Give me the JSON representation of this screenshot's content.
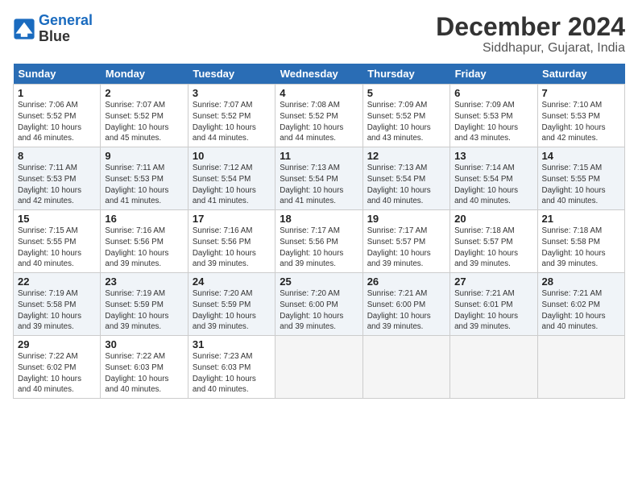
{
  "header": {
    "logo_line1": "General",
    "logo_line2": "Blue",
    "month": "December 2024",
    "location": "Siddhapur, Gujarat, India"
  },
  "weekdays": [
    "Sunday",
    "Monday",
    "Tuesday",
    "Wednesday",
    "Thursday",
    "Friday",
    "Saturday"
  ],
  "weeks": [
    [
      {
        "day": 1,
        "rise": "7:06 AM",
        "set": "5:52 PM",
        "daylight": "10 hours and 46 minutes."
      },
      {
        "day": 2,
        "rise": "7:07 AM",
        "set": "5:52 PM",
        "daylight": "10 hours and 45 minutes."
      },
      {
        "day": 3,
        "rise": "7:07 AM",
        "set": "5:52 PM",
        "daylight": "10 hours and 44 minutes."
      },
      {
        "day": 4,
        "rise": "7:08 AM",
        "set": "5:52 PM",
        "daylight": "10 hours and 44 minutes."
      },
      {
        "day": 5,
        "rise": "7:09 AM",
        "set": "5:52 PM",
        "daylight": "10 hours and 43 minutes."
      },
      {
        "day": 6,
        "rise": "7:09 AM",
        "set": "5:53 PM",
        "daylight": "10 hours and 43 minutes."
      },
      {
        "day": 7,
        "rise": "7:10 AM",
        "set": "5:53 PM",
        "daylight": "10 hours and 42 minutes."
      }
    ],
    [
      {
        "day": 8,
        "rise": "7:11 AM",
        "set": "5:53 PM",
        "daylight": "10 hours and 42 minutes."
      },
      {
        "day": 9,
        "rise": "7:11 AM",
        "set": "5:53 PM",
        "daylight": "10 hours and 41 minutes."
      },
      {
        "day": 10,
        "rise": "7:12 AM",
        "set": "5:54 PM",
        "daylight": "10 hours and 41 minutes."
      },
      {
        "day": 11,
        "rise": "7:13 AM",
        "set": "5:54 PM",
        "daylight": "10 hours and 41 minutes."
      },
      {
        "day": 12,
        "rise": "7:13 AM",
        "set": "5:54 PM",
        "daylight": "10 hours and 40 minutes."
      },
      {
        "day": 13,
        "rise": "7:14 AM",
        "set": "5:54 PM",
        "daylight": "10 hours and 40 minutes."
      },
      {
        "day": 14,
        "rise": "7:15 AM",
        "set": "5:55 PM",
        "daylight": "10 hours and 40 minutes."
      }
    ],
    [
      {
        "day": 15,
        "rise": "7:15 AM",
        "set": "5:55 PM",
        "daylight": "10 hours and 40 minutes."
      },
      {
        "day": 16,
        "rise": "7:16 AM",
        "set": "5:56 PM",
        "daylight": "10 hours and 39 minutes."
      },
      {
        "day": 17,
        "rise": "7:16 AM",
        "set": "5:56 PM",
        "daylight": "10 hours and 39 minutes."
      },
      {
        "day": 18,
        "rise": "7:17 AM",
        "set": "5:56 PM",
        "daylight": "10 hours and 39 minutes."
      },
      {
        "day": 19,
        "rise": "7:17 AM",
        "set": "5:57 PM",
        "daylight": "10 hours and 39 minutes."
      },
      {
        "day": 20,
        "rise": "7:18 AM",
        "set": "5:57 PM",
        "daylight": "10 hours and 39 minutes."
      },
      {
        "day": 21,
        "rise": "7:18 AM",
        "set": "5:58 PM",
        "daylight": "10 hours and 39 minutes."
      }
    ],
    [
      {
        "day": 22,
        "rise": "7:19 AM",
        "set": "5:58 PM",
        "daylight": "10 hours and 39 minutes."
      },
      {
        "day": 23,
        "rise": "7:19 AM",
        "set": "5:59 PM",
        "daylight": "10 hours and 39 minutes."
      },
      {
        "day": 24,
        "rise": "7:20 AM",
        "set": "5:59 PM",
        "daylight": "10 hours and 39 minutes."
      },
      {
        "day": 25,
        "rise": "7:20 AM",
        "set": "6:00 PM",
        "daylight": "10 hours and 39 minutes."
      },
      {
        "day": 26,
        "rise": "7:21 AM",
        "set": "6:00 PM",
        "daylight": "10 hours and 39 minutes."
      },
      {
        "day": 27,
        "rise": "7:21 AM",
        "set": "6:01 PM",
        "daylight": "10 hours and 39 minutes."
      },
      {
        "day": 28,
        "rise": "7:21 AM",
        "set": "6:02 PM",
        "daylight": "10 hours and 40 minutes."
      }
    ],
    [
      {
        "day": 29,
        "rise": "7:22 AM",
        "set": "6:02 PM",
        "daylight": "10 hours and 40 minutes."
      },
      {
        "day": 30,
        "rise": "7:22 AM",
        "set": "6:03 PM",
        "daylight": "10 hours and 40 minutes."
      },
      {
        "day": 31,
        "rise": "7:23 AM",
        "set": "6:03 PM",
        "daylight": "10 hours and 40 minutes."
      },
      null,
      null,
      null,
      null
    ]
  ]
}
